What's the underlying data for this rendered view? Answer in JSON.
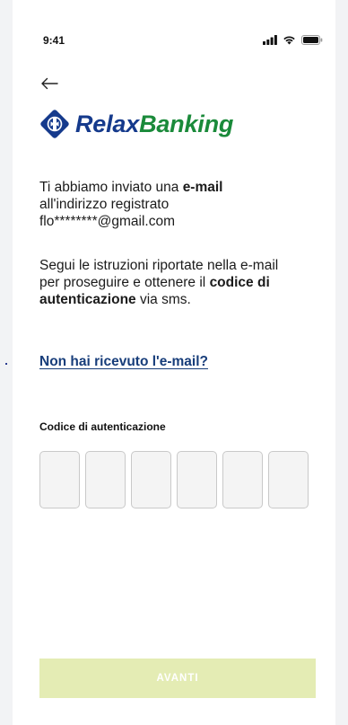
{
  "status_bar": {
    "time": "9:41",
    "icons": [
      "signal-icon",
      "wifi-icon",
      "battery-icon"
    ]
  },
  "header": {
    "back_icon": "arrow-left-icon",
    "logo": {
      "part1": "Relax",
      "part2": "Banking",
      "colors": {
        "blue": "#153a8c",
        "green": "#1a8a3a"
      }
    }
  },
  "message1": {
    "line1_prefix": "Ti abbiamo inviato una ",
    "line1_bold": "e-mail",
    "line2": "all'indirizzo registrato",
    "line3": "flo********@gmail.com"
  },
  "message2": {
    "line1": "Segui le istruzioni riportate nella e-mail",
    "line2_prefix": "per proseguire e ottenere il ",
    "line2_bold": "codice di",
    "line3_bold": "autenticazione",
    "line3_suffix": " via sms."
  },
  "resend_link": "Non hai ricevuto l'e-mail?",
  "code": {
    "label": "Codice di autenticazione",
    "digits": [
      "",
      "",
      "",
      "",
      "",
      ""
    ]
  },
  "cta": {
    "label": "AVANTI",
    "color": "#e4ecb4"
  }
}
